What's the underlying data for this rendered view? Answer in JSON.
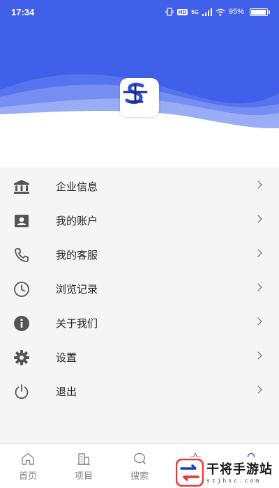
{
  "status_bar": {
    "time": "17:34",
    "network_badge": "HD",
    "network_type": "5G",
    "battery_percent": "95%",
    "battery_level": 0.95
  },
  "header": {
    "logo_icon": "s-logo-icon",
    "colors": {
      "primary": "#4060ea",
      "wave_light": "#7b93f2"
    }
  },
  "menu": {
    "items": [
      {
        "label": "企业信息",
        "icon": "bank-icon"
      },
      {
        "label": "我的账户",
        "icon": "account-icon"
      },
      {
        "label": "我的客服",
        "icon": "phone-icon"
      },
      {
        "label": "浏览记录",
        "icon": "clock-icon"
      },
      {
        "label": "关于我们",
        "icon": "info-icon"
      },
      {
        "label": "设置",
        "icon": "gear-icon"
      },
      {
        "label": "退出",
        "icon": "power-icon"
      }
    ]
  },
  "bottom_nav": {
    "items": [
      {
        "label": "首页",
        "icon": "home-icon"
      },
      {
        "label": "项目",
        "icon": "building-icon"
      },
      {
        "label": "搜索",
        "icon": "search-icon"
      },
      {
        "label": "",
        "icon": "star-icon"
      },
      {
        "label": "",
        "icon": "user-icon"
      }
    ]
  },
  "watermark": {
    "title": "干将手游站",
    "subtitle": "szjhsc.com"
  }
}
